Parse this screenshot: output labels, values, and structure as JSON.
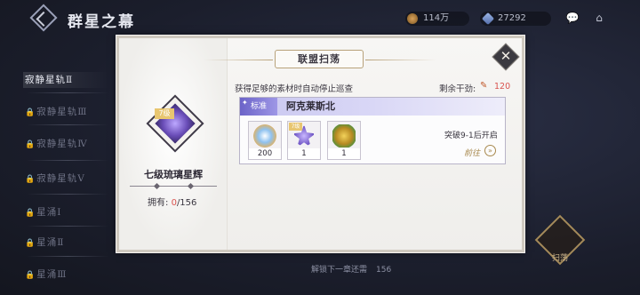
{
  "header": {
    "title": "群星之幕",
    "resources": [
      {
        "icon": "coin-icon",
        "value": "114万"
      },
      {
        "icon": "crystal-icon",
        "value": "27292"
      }
    ]
  },
  "sidebar": {
    "items": [
      {
        "label": "寂静星轨Ⅱ",
        "locked": false,
        "active": true
      },
      {
        "label": "寂静星轨Ⅲ",
        "locked": true,
        "active": false
      },
      {
        "label": "寂静星轨Ⅳ",
        "locked": true,
        "active": false
      },
      {
        "label": "寂静星轨Ⅴ",
        "locked": true,
        "active": false
      },
      {
        "label": "星涌Ⅰ",
        "locked": true,
        "active": false
      },
      {
        "label": "星涌Ⅱ",
        "locked": true,
        "active": false
      },
      {
        "label": "星涌Ⅲ",
        "locked": true,
        "active": false
      }
    ]
  },
  "bottom": {
    "hint": "解锁下一章还需",
    "count": "156",
    "scan_label": "扫荡"
  },
  "modal": {
    "title": "联盟扫荡",
    "item": {
      "level": "7级",
      "name": "七级琉璃星辉",
      "own_label": "拥有:",
      "own_current": "0",
      "own_total": "/156"
    },
    "notice": "获得足够的素材时自动停止巡查",
    "stamina": {
      "label": "剩余干劲:",
      "value": "120"
    },
    "stage": {
      "tag": "标准",
      "name": "阿克莱斯北",
      "rewards": [
        {
          "name": "star-shard-icon",
          "count": "200"
        },
        {
          "name": "glass-star-icon",
          "count": "1",
          "level": "7级"
        },
        {
          "name": "gift-bundle-icon",
          "count": "1"
        }
      ],
      "unlock_text": "突破9-1后开启",
      "goto_label": "前往"
    }
  },
  "colors": {
    "accent_red": "#d9534f",
    "gold": "#a8894e",
    "stage_tag": "#6b63c8"
  }
}
